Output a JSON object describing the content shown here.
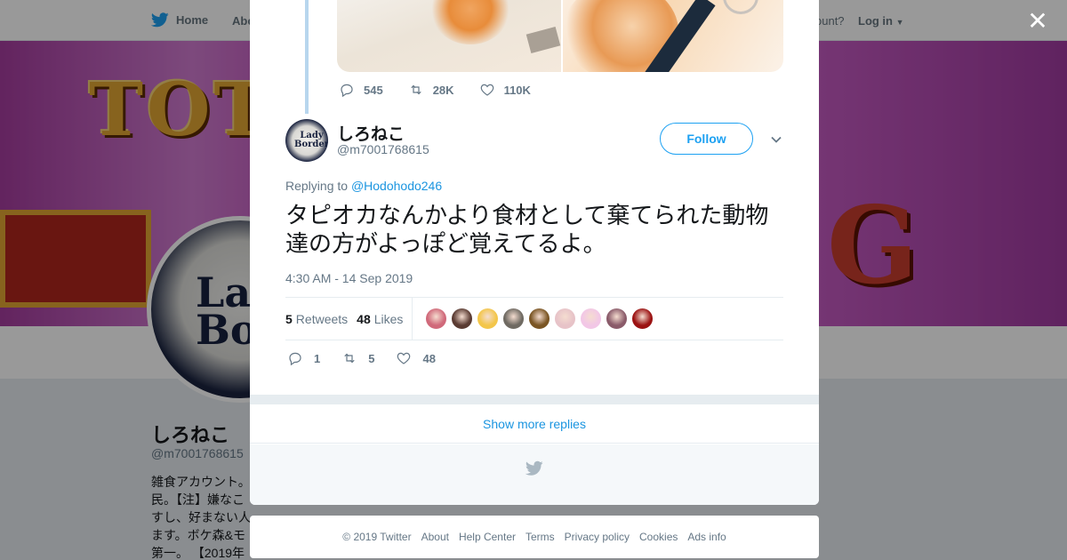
{
  "nav": {
    "home_label": "Home",
    "about_label": "Abo",
    "account_text": "ccount?",
    "login_label": "Log in"
  },
  "profile": {
    "name": "しろねこ",
    "handle": "@m7001768615",
    "bio": "雑食アカウント。\n民。【注】嫌なこ\nすし、好まない人\nます。ボケ森&モ\n第一。 【2019年",
    "banner_word_1": "TOTA",
    "banner_word_2": "G",
    "avatar_text": "Lady Bord"
  },
  "parent_tweet": {
    "replies": "545",
    "retweets": "28K",
    "likes": "110K"
  },
  "tweet": {
    "author_name": "しろねこ",
    "author_handle": "@m7001768615",
    "avatar_text": "Lady Border",
    "follow_label": "Follow",
    "replying_prefix": "Replying to",
    "replying_to": "@Hodohodo246",
    "text": "タピオカなんかより食材として棄てられた動物達の方がよっぽど覚えてるよ。",
    "timestamp": "4:30 AM - 14 Sep 2019",
    "retweets_count": "5",
    "retweets_label": "Retweets",
    "likes_count": "48",
    "likes_label": "Likes",
    "action_replies": "1",
    "action_retweets": "5",
    "action_likes": "48",
    "liker_colors": [
      "#d0697a",
      "#5a3b32",
      "#f3c64a",
      "#6f6a62",
      "#7a5524",
      "#e7c3c8",
      "#f2c7e6",
      "#8a5b6a",
      "#9b1212"
    ]
  },
  "show_more_label": "Show more replies",
  "footer": {
    "links": [
      "© 2019 Twitter",
      "About",
      "Help Center",
      "Terms",
      "Privacy policy",
      "Cookies",
      "Ads info"
    ]
  },
  "colors": {
    "twitter_blue": "#1da1f2",
    "link_blue": "#1b95e0",
    "muted_gray": "#657786"
  },
  "icons": {
    "close": "close-icon",
    "twitter": "twitter-bird-icon"
  }
}
